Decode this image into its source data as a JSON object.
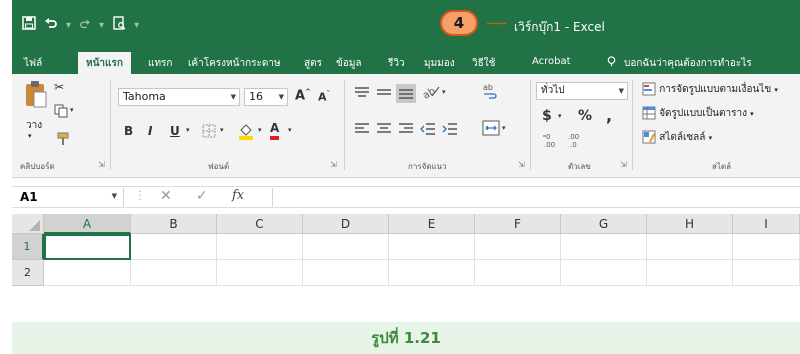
{
  "titlebar": {
    "callout_number": "4",
    "doc_title": "เวิร์กบุ๊ก1 - Excel",
    "save_icon": "save-icon",
    "undo_icon": "undo-icon",
    "redo_icon": "redo-icon",
    "preview_icon": "print-preview-icon"
  },
  "tabs": {
    "file": "ไฟล์",
    "home": "หน้าแรก",
    "insert": "แทรก",
    "page_layout": "เค้าโครงหน้ากระดาษ",
    "formulas": "สูตร",
    "data": "ข้อมูล",
    "review": "รีวิว",
    "view": "มุมมอง",
    "video": "วิธีใช้",
    "acrobat": "Acrobat",
    "tell_me": "บอกฉันว่าคุณต้องการทำอะไร"
  },
  "ribbon": {
    "clipboard": {
      "paste": "วาง",
      "label": "คลิปบอร์ด"
    },
    "font": {
      "name": "Tahoma",
      "size": "16",
      "bold": "B",
      "italic": "I",
      "underline": "U",
      "label": "ฟอนต์",
      "grow": "A",
      "shrink": "A",
      "font_color": "A"
    },
    "alignment": {
      "label": "การจัดแนว"
    },
    "number": {
      "format": "ทั่วไป",
      "currency": "$",
      "percent": "%",
      "comma": ",",
      "label": "ตัวเลข"
    },
    "styles": {
      "conditional": "การจัดรูปแบบตามเงื่อนไข",
      "format_table": "จัดรูปแบบเป็นตาราง",
      "cell_styles": "สไตล์เซลล์",
      "label": "สไตล์"
    }
  },
  "formula_bar": {
    "name_box": "A1",
    "fx": "fx",
    "cancel": "✕",
    "enter": "✓"
  },
  "grid": {
    "columns": [
      "A",
      "B",
      "C",
      "D",
      "E",
      "F",
      "G",
      "H",
      "I"
    ],
    "rows": [
      "1",
      "2"
    ],
    "active_cell": "A1"
  },
  "caption": "รูปที่ 1.21",
  "colors": {
    "excel_green": "#217346",
    "callout_fill": "#f5a068",
    "callout_arrow": "#d9541c",
    "caption_bg": "#e7f4e7"
  }
}
